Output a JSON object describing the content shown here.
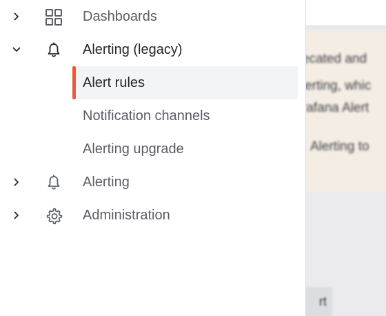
{
  "nav": {
    "items": [
      {
        "label": "Dashboards",
        "expanded": false,
        "icon": "dashboards-grid-icon"
      },
      {
        "label": "Alerting (legacy)",
        "expanded": true,
        "icon": "bell-icon",
        "children": [
          {
            "label": "Alert rules",
            "active": true
          },
          {
            "label": "Notification channels",
            "active": false
          },
          {
            "label": "Alerting upgrade",
            "active": false
          }
        ]
      },
      {
        "label": "Alerting",
        "expanded": false,
        "icon": "bell-icon"
      },
      {
        "label": "Administration",
        "expanded": false,
        "icon": "gear-icon"
      }
    ],
    "active_accent": "#f05a28"
  },
  "background": {
    "banner_lines": [
      "ecated and",
      "lerting, whic",
      "rafana Alert",
      "Alerting to"
    ],
    "button_label": "rt"
  }
}
